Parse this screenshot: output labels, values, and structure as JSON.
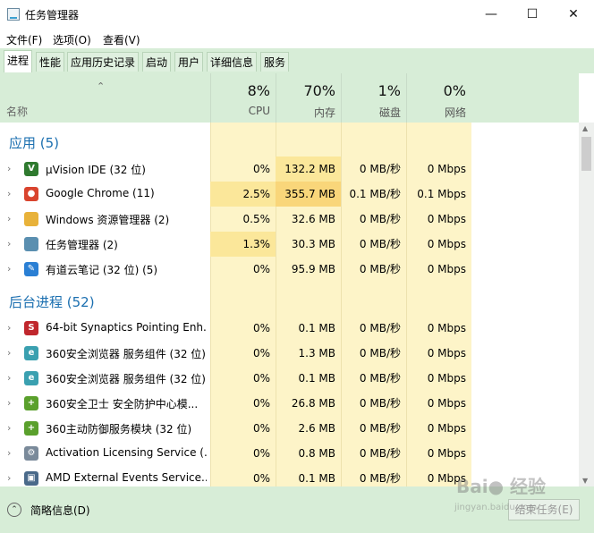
{
  "window": {
    "title": "任务管理器"
  },
  "menu": [
    "文件(F)",
    "选项(O)",
    "查看(V)"
  ],
  "tabs": [
    "进程",
    "性能",
    "应用历史记录",
    "启动",
    "用户",
    "详细信息",
    "服务"
  ],
  "columns": {
    "name": "名称",
    "cpu": {
      "pct": "8%",
      "label": "CPU"
    },
    "mem": {
      "pct": "70%",
      "label": "内存"
    },
    "disk": {
      "pct": "1%",
      "label": "磁盘"
    },
    "net": {
      "pct": "0%",
      "label": "网络"
    }
  },
  "groups": {
    "apps": "应用 (5)",
    "background": "后台进程 (52)"
  },
  "apps": [
    {
      "name": "µVision IDE (32 位)",
      "cpu": "0%",
      "mem": "132.2 MB",
      "disk": "0 MB/秒",
      "net": "0 Mbps",
      "icon": "uvision-icon"
    },
    {
      "name": "Google Chrome (11)",
      "cpu": "2.5%",
      "mem": "355.7 MB",
      "disk": "0.1 MB/秒",
      "net": "0.1 Mbps",
      "icon": "chrome-icon"
    },
    {
      "name": "Windows 资源管理器 (2)",
      "cpu": "0.5%",
      "mem": "32.6 MB",
      "disk": "0 MB/秒",
      "net": "0 Mbps",
      "icon": "folder-icon"
    },
    {
      "name": "任务管理器 (2)",
      "cpu": "1.3%",
      "mem": "30.3 MB",
      "disk": "0 MB/秒",
      "net": "0 Mbps",
      "icon": "task-manager-icon"
    },
    {
      "name": "有道云笔记 (32 位) (5)",
      "cpu": "0%",
      "mem": "95.9 MB",
      "disk": "0 MB/秒",
      "net": "0 Mbps",
      "icon": "youdao-note-icon"
    }
  ],
  "background": [
    {
      "name": "64-bit Synaptics Pointing Enh...",
      "cpu": "0%",
      "mem": "0.1 MB",
      "disk": "0 MB/秒",
      "net": "0 Mbps",
      "icon": "synaptics-icon"
    },
    {
      "name": "360安全浏览器 服务组件 (32 位)",
      "cpu": "0%",
      "mem": "1.3 MB",
      "disk": "0 MB/秒",
      "net": "0 Mbps",
      "icon": "360-browser-icon"
    },
    {
      "name": "360安全浏览器 服务组件 (32 位)",
      "cpu": "0%",
      "mem": "0.1 MB",
      "disk": "0 MB/秒",
      "net": "0 Mbps",
      "icon": "360-browser-icon"
    },
    {
      "name": "360安全卫士 安全防护中心模...",
      "cpu": "0%",
      "mem": "26.8 MB",
      "disk": "0 MB/秒",
      "net": "0 Mbps",
      "icon": "360-safe-icon"
    },
    {
      "name": "360主动防御服务模块 (32 位)",
      "cpu": "0%",
      "mem": "2.6 MB",
      "disk": "0 MB/秒",
      "net": "0 Mbps",
      "icon": "360-safe-icon"
    },
    {
      "name": "Activation Licensing Service (...",
      "cpu": "0%",
      "mem": "0.8 MB",
      "disk": "0 MB/秒",
      "net": "0 Mbps",
      "icon": "service-gear-icon"
    },
    {
      "name": "AMD External Events Service...",
      "cpu": "0%",
      "mem": "0.1 MB",
      "disk": "0 MB/秒",
      "net": "0 Mbps",
      "icon": "amd-service-icon"
    }
  ],
  "footer": {
    "details": "简略信息(D)",
    "end_task": "结束任务(E)"
  },
  "watermark": {
    "logo": "Baidu 经验",
    "url": "jingyan.baidu.com"
  },
  "colors": {
    "heat_low": "#fdf4c8",
    "heat_mid": "#fbe79a",
    "heat_high": "#f9d67a",
    "accent": "#1b6fb0"
  }
}
